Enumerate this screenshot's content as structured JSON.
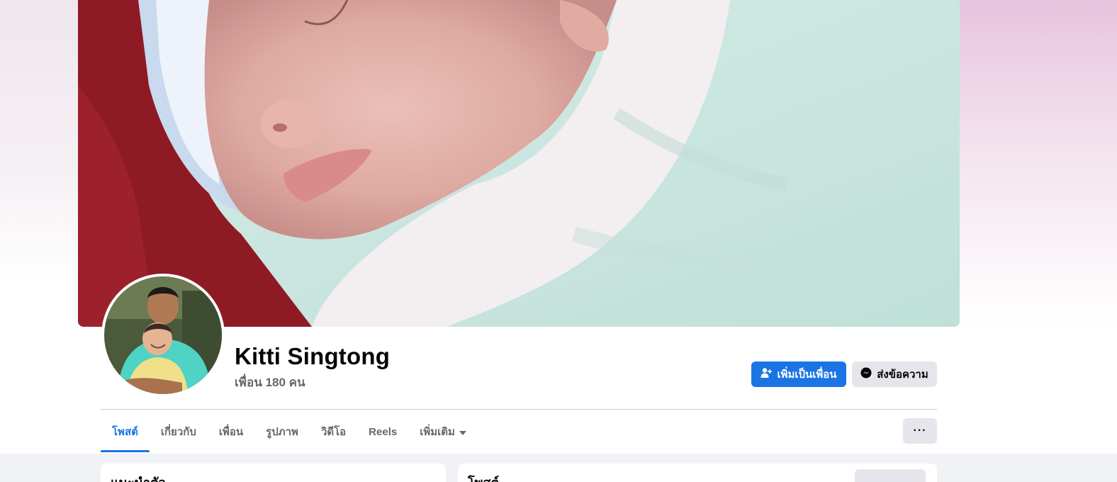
{
  "profile": {
    "name": "Kitti Singtong",
    "friends_count": "เพื่อน 180 คน"
  },
  "actions": {
    "add_friend_label": "เพิ่มเป็นเพื่อน",
    "message_label": "ส่งข้อความ",
    "more_label": "···"
  },
  "tabs": [
    {
      "label": "โพสต์",
      "active": true
    },
    {
      "label": "เกี่ยวกับ",
      "active": false
    },
    {
      "label": "เพื่อน",
      "active": false
    },
    {
      "label": "รูปภาพ",
      "active": false
    },
    {
      "label": "วิดีโอ",
      "active": false
    },
    {
      "label": "Reels",
      "active": false
    },
    {
      "label": "เพิ่มเติม",
      "active": false,
      "has_dropdown": true
    }
  ],
  "cards": {
    "intro_title": "แนะนำตัว",
    "posts_title": "โพสต์"
  },
  "colors": {
    "accent": "#1b74e4",
    "text_secondary": "#65676b",
    "button_gray": "#e4e6eb"
  }
}
